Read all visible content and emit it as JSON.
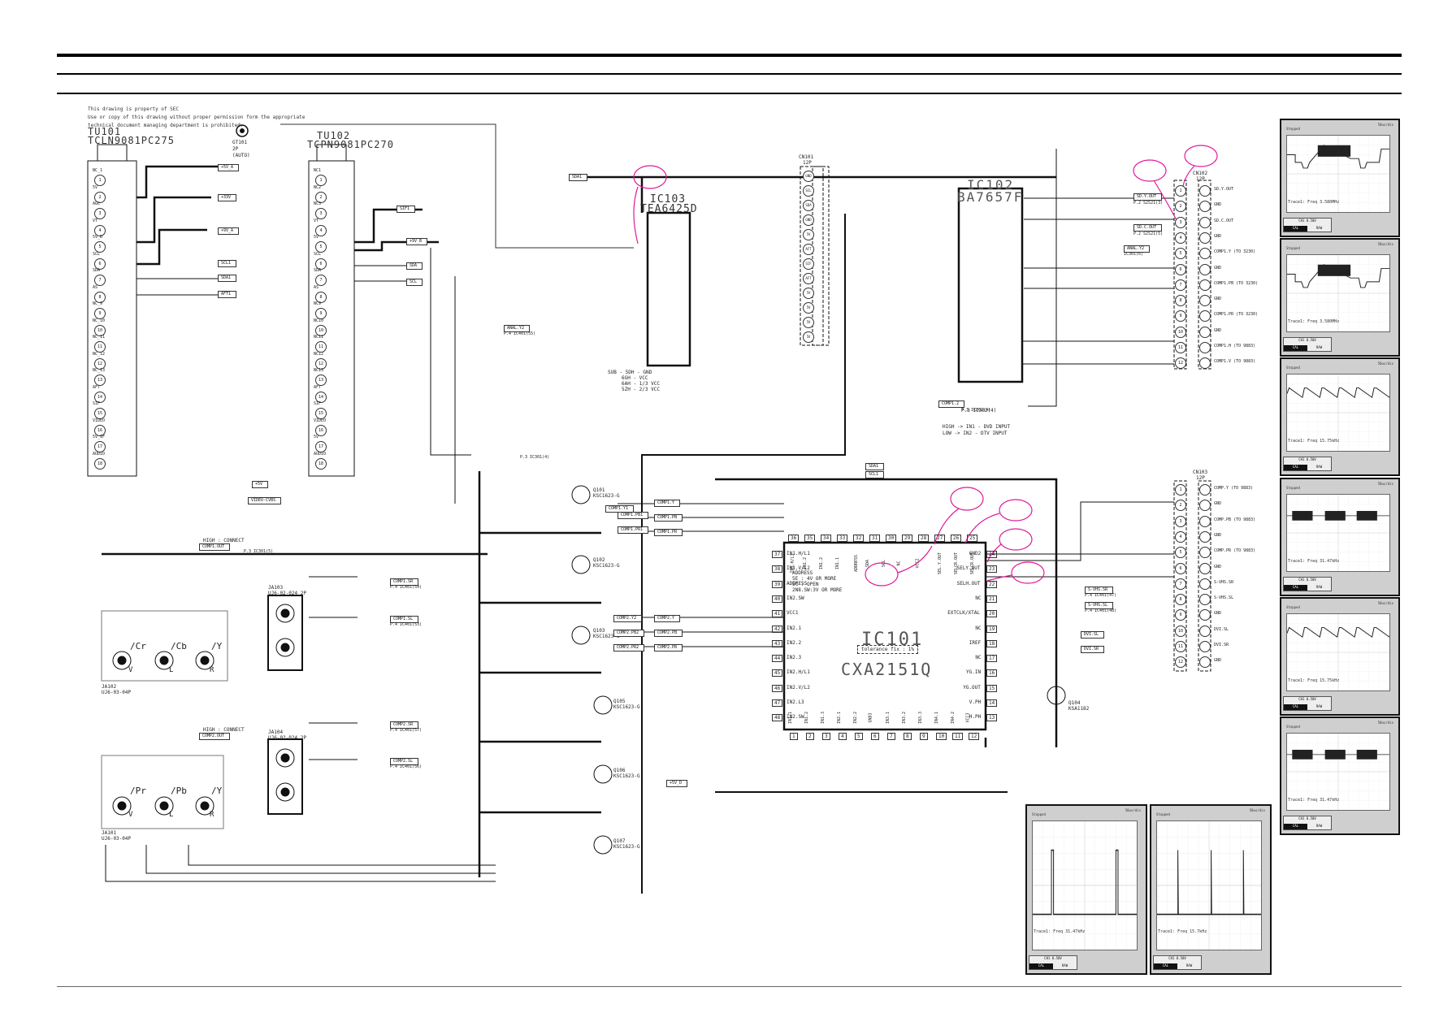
{
  "notice": {
    "line1": "This drawing is property of SEC",
    "line2": "Use or copy of this drawing without proper permission form the appropriate",
    "line3": "technical document managing department is prohibited."
  },
  "tuners": [
    {
      "ref": "TU101",
      "part": "TCLN9081PC275",
      "pins": [
        "NC_1",
        "5V",
        "AGC",
        "VT",
        "5V_B",
        "SCL",
        "SDA",
        "AS",
        "NC_9",
        "NC_10",
        "NC_11",
        "NC_12",
        "NC_13",
        "AFT",
        "SIF",
        "VIDEO",
        "5V_IF",
        "AUDIO"
      ]
    },
    {
      "ref": "TU102",
      "part": "TCPN9081PC270",
      "pins": [
        "NC1",
        "NC2",
        "NC3",
        "VT",
        "5V",
        "SCL",
        "SDA",
        "AS",
        "NC9",
        "NC10",
        "NC11",
        "NC12",
        "NC13",
        "AFT",
        "SIF",
        "VIDEO",
        "5V",
        "AUDIO"
      ]
    }
  ],
  "antenna": {
    "ref": "GT101",
    "spec": "2P",
    "note": "(AUTO)"
  },
  "ics": [
    {
      "ref": "IC103",
      "part": "TEA6425D",
      "note": [
        "SUB - 5DH - GND",
        "6GH - VCC",
        "6AH - 1/3 VCC",
        "5ZH - 2/3 VCC"
      ]
    },
    {
      "ref": "IC102",
      "part": "BA7657F",
      "note": [
        "P.3 IC302(4)",
        "HIGH -> IN1 - DVD INPUT",
        "LOW -> IN2 - DTV INPUT"
      ]
    },
    {
      "ref": "IC101",
      "part": "CXA2151Q",
      "tolerance": "tolerance fix : 1%",
      "address_note": [
        "ADDRESS",
        "5E : 4V OR MORE",
        "5C : OPEN",
        "2N8.SW:3V OR MORE"
      ],
      "top_pins": [
        {
          "n": "36",
          "l": "IN1.H/L1"
        },
        {
          "n": "35",
          "l": "IN1.2"
        },
        {
          "n": "34",
          "l": "IN1.2"
        },
        {
          "n": "33",
          "l": "IN1.1"
        },
        {
          "n": "32",
          "l": "ADDRESS"
        },
        {
          "n": "31",
          "l": "SDA"
        },
        {
          "n": "30",
          "l": "SCL"
        },
        {
          "n": "29",
          "l": "NC"
        },
        {
          "n": "28",
          "l": "VCC2"
        },
        {
          "n": "27",
          "l": "SEL.Y.OUT"
        },
        {
          "n": "26",
          "l": "SELCR.OUT"
        },
        {
          "n": "25",
          "l": "SELCR.OUT"
        }
      ],
      "right_pins": [
        {
          "n": "24",
          "l": "GND2"
        },
        {
          "n": "23",
          "l": "SELY.OUT"
        },
        {
          "n": "22",
          "l": "SELH.OUT"
        },
        {
          "n": "21",
          "l": "NC"
        },
        {
          "n": "20",
          "l": "EXTCLK/XTAL"
        },
        {
          "n": "19",
          "l": "NC"
        },
        {
          "n": "18",
          "l": "IREF"
        },
        {
          "n": "17",
          "l": "NC"
        },
        {
          "n": "16",
          "l": "YG.IN"
        },
        {
          "n": "15",
          "l": "YG.OUT"
        },
        {
          "n": "14",
          "l": "V.PH"
        },
        {
          "n": "13",
          "l": "H.PH"
        }
      ],
      "left_pins": [
        {
          "n": "37",
          "l": "IN1.H/L1"
        },
        {
          "n": "38",
          "l": "IN1.V/L2"
        },
        {
          "n": "39",
          "l": "ADDRESS"
        },
        {
          "n": "40",
          "l": "IN2.SW"
        },
        {
          "n": "41",
          "l": "VCC1"
        },
        {
          "n": "42",
          "l": "IN2.1"
        },
        {
          "n": "43",
          "l": "IN2.2"
        },
        {
          "n": "44",
          "l": "IN2.3"
        },
        {
          "n": "45",
          "l": "IN2.H/L1"
        },
        {
          "n": "46",
          "l": "IN2.V/L2"
        },
        {
          "n": "47",
          "l": "IN2.L3"
        },
        {
          "n": "48",
          "l": "IN2.SW"
        }
      ],
      "bottom_pins": [
        {
          "n": "1",
          "l": "IN1.1"
        },
        {
          "n": "2",
          "l": "IN1.2"
        },
        {
          "n": "3",
          "l": "IN1.3"
        },
        {
          "n": "4",
          "l": "IN2.1"
        },
        {
          "n": "5",
          "l": "IN2.2"
        },
        {
          "n": "6",
          "l": "GND3"
        },
        {
          "n": "7",
          "l": "IN3.1"
        },
        {
          "n": "8",
          "l": "IN3.2"
        },
        {
          "n": "9",
          "l": "IN3.3"
        },
        {
          "n": "10",
          "l": "IN4.1"
        },
        {
          "n": "11",
          "l": "IN4.2"
        },
        {
          "n": "12",
          "l": "VCC3"
        }
      ]
    }
  ],
  "connectors": [
    {
      "ref": "CN101",
      "spec": "12P",
      "pins": [
        "GND",
        "SCL",
        "SDA",
        "GND",
        "5V",
        "AFT",
        "SIF",
        "AFT",
        "5V",
        "5V",
        "5V",
        "5V"
      ]
    },
    {
      "ref": "CN102",
      "spec": "12P",
      "labels": [
        "SD.Y.OUT",
        "GND",
        "SD.C.OUT",
        "GND",
        "COMP1.Y (TO 3230)",
        "GND",
        "COMP1.PB (TO 3230)",
        "GND",
        "COMP1.PR (TO 3230)",
        "GND",
        "COMP1.H (TO 9883)",
        "COMP1.V (TO 9883)"
      ]
    },
    {
      "ref": "CN103",
      "spec": "12P",
      "labels": [
        "COMP.Y (TO 9883)",
        "GND",
        "COMP.PB (TO 9883)",
        "GND",
        "COMP.PR (TO 9883)",
        "GND",
        "S-VHS.SR",
        "S-VHS.SL",
        "GND",
        "DVI.SL",
        "DVI.SR",
        "GND"
      ]
    }
  ],
  "jacks": [
    {
      "ref": "JA102",
      "part": "UJ6-03-04P",
      "labels": [
        "/Cr",
        "/Cb",
        "/Y"
      ],
      "sub": [
        "V",
        "L",
        "R"
      ]
    },
    {
      "ref": "JA103",
      "part": "UJ6-02-024 2P"
    },
    {
      "ref": "JA104",
      "part": "UJ6-02-024 2P"
    },
    {
      "ref": "JA101",
      "part": "UJ6-03-04P",
      "labels": [
        "/Pr",
        "/Pb",
        "/Y"
      ],
      "sub": [
        "V",
        "L",
        "R"
      ]
    }
  ],
  "transistors": [
    {
      "ref": "Q101",
      "part": "KSC1623-G"
    },
    {
      "ref": "Q102",
      "part": "KSC1623-G"
    },
    {
      "ref": "Q103",
      "part": "KSC1623-G"
    },
    {
      "ref": "Q105",
      "part": "KSC1623-G"
    },
    {
      "ref": "Q106",
      "part": "KSC1623-G"
    },
    {
      "ref": "Q107",
      "part": "KSC1623-G"
    },
    {
      "ref": "Q104",
      "part": "KSA1182"
    }
  ],
  "net_tags": [
    "+5V_A",
    "+33V",
    "+9V_A",
    "SCL1",
    "SDA1",
    "AFT1",
    "SIF1",
    "+9V_B",
    "SCL",
    "SDA",
    "SDA1",
    "+5V",
    "VIDEO-CVBS",
    "ANAL.Y2",
    "SD.Y.OUT",
    "SD.C.OUT",
    "ANAL.Y2",
    "COMP1.Y",
    "COMP1.PB",
    "COMP1.PR",
    "COMP2.Y",
    "COMP2.PB",
    "COMP2.PR",
    "COMP1.2",
    "S-VHS.SR",
    "S-VHS.SL",
    "DVI.SL",
    "DVI.SR",
    "COMP1.SR",
    "COMP1.SL",
    "COMP2.SR",
    "COMP2.SL",
    "COMP1.Y1",
    "COMP1.PB1",
    "COMP1.PR1",
    "COMP2.Y2",
    "COMP2.PB2",
    "COMP2.PR2",
    "+5V_D",
    "SDA1",
    "SCL1"
  ],
  "cross_refs": [
    "P.2 S2S21(3)",
    "P.2 S2S21(5)",
    "IC301(6)",
    "P.3 IC301(4)",
    "P.3 IC302(4)",
    "P.4 IC401(54)",
    "P.4 IC401(53)",
    "P.4 IC401(47)",
    "P.4 IC401(48)",
    "P.4 IC401(57)",
    "P.4 IC401(56)",
    "P.4 IC401(55)",
    "P.3 IC301(5)"
  ],
  "mux_notes": [
    "HIGH : CONNECT",
    "COMP1.OUT",
    "HIGH : CONNECT",
    "COMP2.OUT"
  ],
  "scopes": [
    {
      "id": "scope-1",
      "freq_label": "Trace1: Freq",
      "freq": "3.580MHz",
      "shape": "ramp-burst"
    },
    {
      "id": "scope-2",
      "freq_label": "Trace1: Freq",
      "freq": "3.580MHz",
      "shape": "ramp-burst"
    },
    {
      "id": "scope-3",
      "freq_label": "Trace1: Freq",
      "freq": "15.75kHz",
      "shape": "sawtooth"
    },
    {
      "id": "scope-4",
      "freq_label": "Trace1: Freq",
      "freq": "31.47kHz",
      "shape": "burst"
    },
    {
      "id": "scope-5",
      "freq_label": "Trace1: Freq",
      "freq": "15.75kHz",
      "shape": "sawtooth"
    },
    {
      "id": "scope-6",
      "freq_label": "Trace1: Freq",
      "freq": "31.47kHz",
      "shape": "burst"
    },
    {
      "id": "scope-7",
      "freq_label": "Trace1: Freq",
      "freq": "31.47kHz",
      "shape": "pulse"
    },
    {
      "id": "scope-8",
      "freq_label": "Trace1: Freq",
      "freq": "15.7kHz",
      "shape": "spike"
    }
  ],
  "scope_ui": {
    "ch_label": "CH1 0.50V",
    "cal": "CAL",
    "raw": "RAW",
    "stopped": "Stopped",
    "timebase": "50us/div"
  },
  "highlight_color": "#e01a9a",
  "watermark_color": "#8a8af0"
}
